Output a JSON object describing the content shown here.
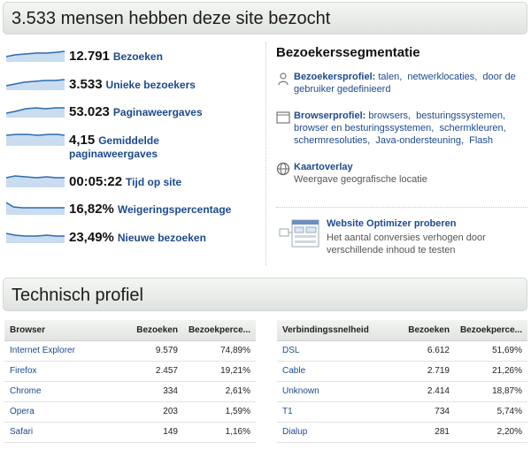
{
  "overview": {
    "title": "3.533 mensen hebben deze site bezocht",
    "metrics": [
      {
        "value": "12.791",
        "label": "Bezoeken",
        "line2": ""
      },
      {
        "value": "3.533",
        "label": "Unieke bezoekers",
        "line2": ""
      },
      {
        "value": "53.023",
        "label": "Paginaweergaves",
        "line2": ""
      },
      {
        "value": "4,15",
        "label": "Gemiddelde",
        "line2": "paginaweergaves"
      },
      {
        "value": "00:05:22",
        "label": "Tijd op site",
        "line2": ""
      },
      {
        "value": "16,82%",
        "label": "Weigeringspercentage",
        "line2": ""
      },
      {
        "value": "23,49%",
        "label": "Nieuwe bezoeken",
        "line2": ""
      }
    ]
  },
  "segmentation": {
    "title": "Bezoekerssegmentatie",
    "visitor_profile": {
      "label": "Bezoekersprofiel:",
      "links": [
        "talen,",
        "netwerklocaties,",
        "door de gebruiker gedefinieerd"
      ]
    },
    "browser_profile": {
      "label": "Browserprofiel:",
      "links": [
        "browsers,",
        "besturingssystemen,",
        "browser en besturingssystemen,",
        "schermkleuren,",
        "schermresoluties,",
        "Java-ondersteuning,",
        "Flash"
      ]
    },
    "map_overlay": {
      "title": "Kaartoverlay",
      "desc": "Weergave geografische locatie"
    },
    "optimizer": {
      "title": "Website Optimizer proberen",
      "desc": "Het aantal conversies verhogen door verschillende inhoud te testen"
    }
  },
  "technical": {
    "title": "Technisch profiel",
    "browser_table": {
      "headers": [
        "Browser",
        "Bezoeken",
        "Bezoekperce..."
      ],
      "rows": [
        [
          "Internet Explorer",
          "9.579",
          "74,89%"
        ],
        [
          "Firefox",
          "2.457",
          "19,21%"
        ],
        [
          "Chrome",
          "334",
          "2,61%"
        ],
        [
          "Opera",
          "203",
          "1,59%"
        ],
        [
          "Safari",
          "149",
          "1,16%"
        ]
      ]
    },
    "connection_table": {
      "headers": [
        "Verbindingssnelheid",
        "Bezoeken",
        "Bezoekperce..."
      ],
      "rows": [
        [
          "DSL",
          "6.612",
          "51,69%"
        ],
        [
          "Cable",
          "2.719",
          "21,26%"
        ],
        [
          "Unknown",
          "2.414",
          "18,87%"
        ],
        [
          "T1",
          "734",
          "5,74%"
        ],
        [
          "Dialup",
          "281",
          "2,20%"
        ]
      ]
    }
  },
  "colors": {
    "sparkline_line": "#2b6cb0",
    "sparkline_fill": "#c9dcf0",
    "link": "#1c4a8c"
  }
}
